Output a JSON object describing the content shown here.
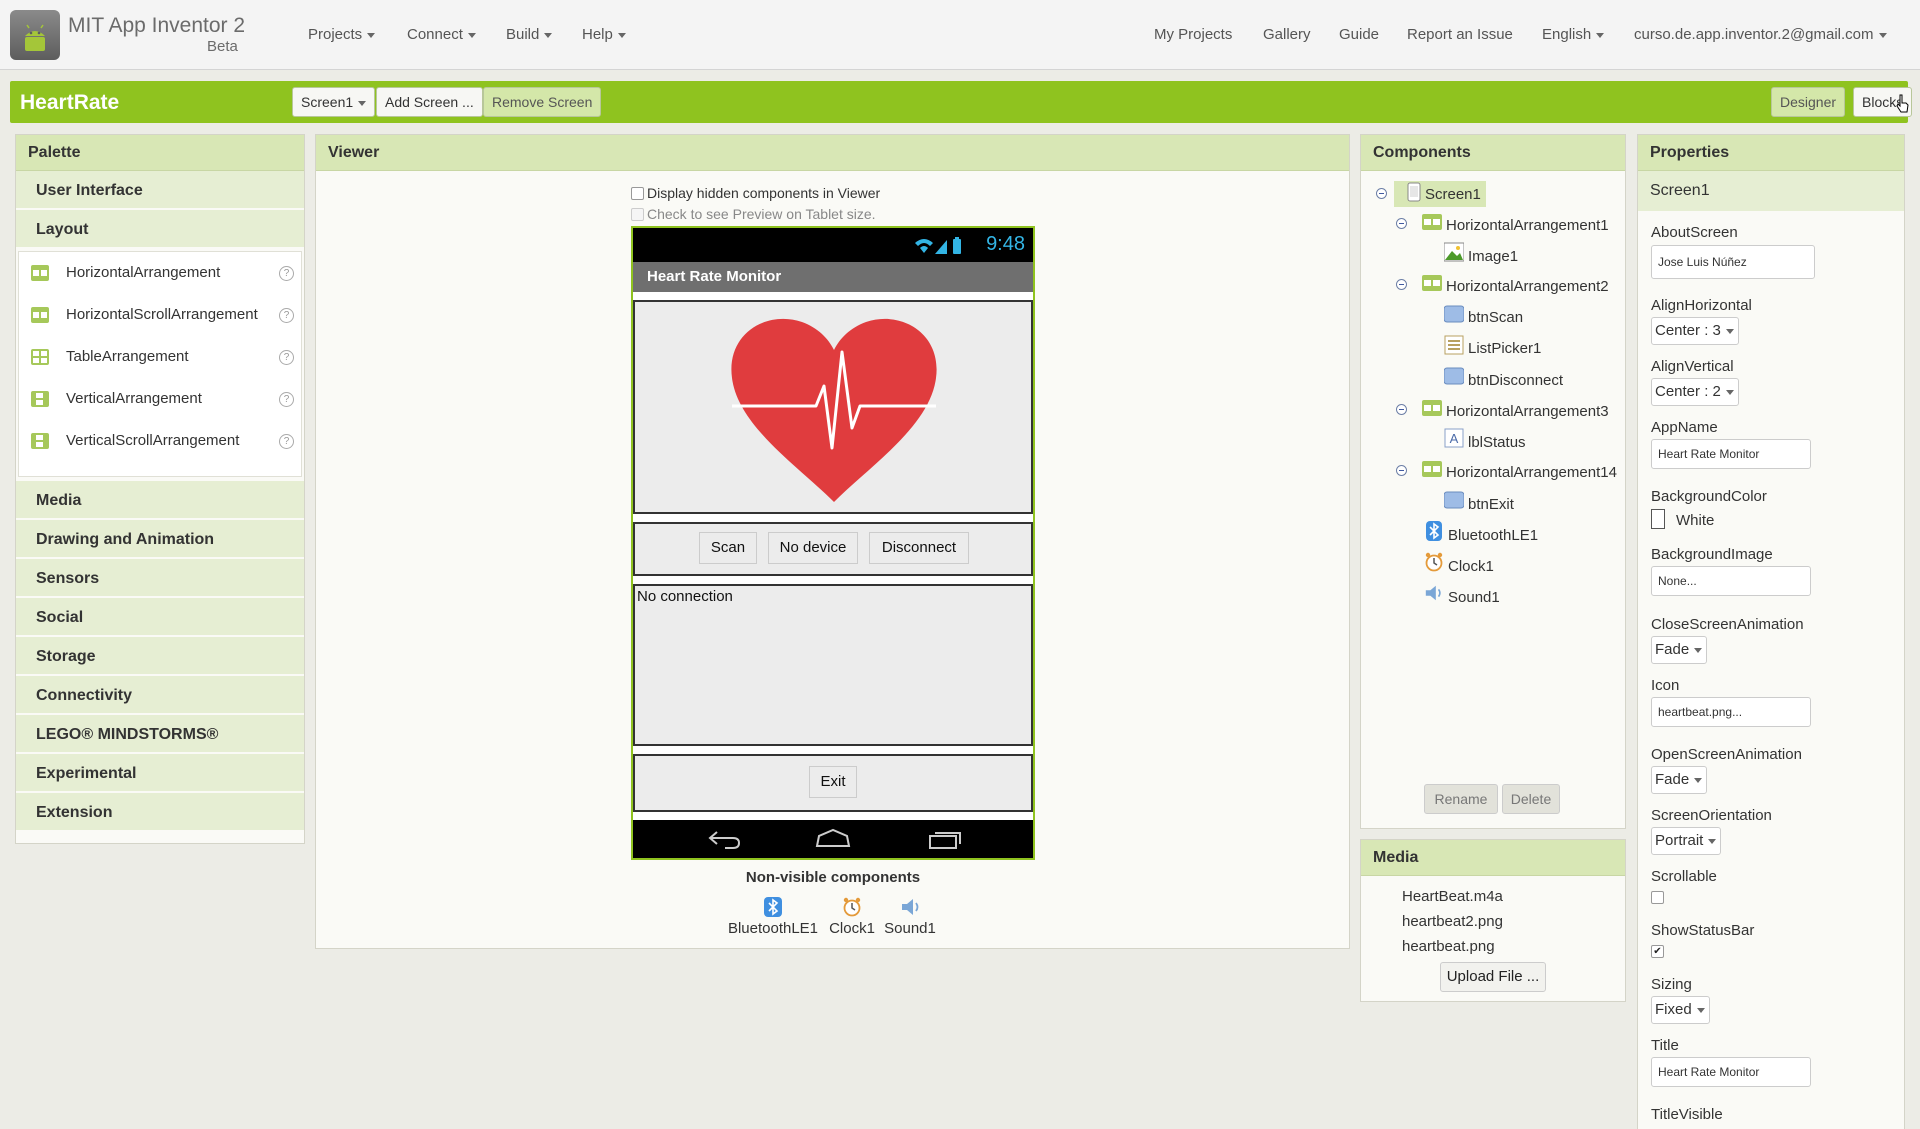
{
  "topbar": {
    "title": "MIT App Inventor 2",
    "subtitle": "Beta",
    "menus": [
      "Projects",
      "Connect",
      "Build",
      "Help"
    ],
    "links": [
      "My Projects",
      "Gallery",
      "Guide",
      "Report an Issue"
    ],
    "language": "English",
    "account": "curso.de.app.inventor.2@gmail.com"
  },
  "project": {
    "name": "HeartRate",
    "screen_select": "Screen1",
    "add_screen": "Add Screen ...",
    "remove_screen": "Remove Screen",
    "designer": "Designer",
    "blocks": "Blocks"
  },
  "palette": {
    "title": "Palette",
    "categories_top": [
      "User Interface",
      "Layout"
    ],
    "layout_items": [
      "HorizontalArrangement",
      "HorizontalScrollArrangement",
      "TableArrangement",
      "VerticalArrangement",
      "VerticalScrollArrangement"
    ],
    "help_glyph": "?",
    "categories_bottom": [
      "Media",
      "Drawing and Animation",
      "Sensors",
      "Social",
      "Storage",
      "Connectivity",
      "LEGO® MINDSTORMS®",
      "Experimental",
      "Extension"
    ]
  },
  "viewer": {
    "title": "Viewer",
    "display_hidden": "Display hidden components in Viewer",
    "tablet_preview": "Check to see Preview on Tablet size.",
    "phone_time": "9:48",
    "app_title": "Heart Rate Monitor",
    "buttons": [
      "Scan",
      "No device",
      "Disconnect"
    ],
    "status_text": "No connection",
    "exit": "Exit",
    "nonvisible_title": "Non-visible components",
    "nonvisible": [
      "BluetoothLE1",
      "Clock1",
      "Sound1"
    ]
  },
  "components": {
    "title": "Components",
    "tree": [
      {
        "label": "Screen1",
        "icon": "screen-icon"
      },
      {
        "label": "HorizontalArrangement1",
        "icon": "horizontal-arrangement-icon"
      },
      {
        "label": "Image1",
        "icon": "image-icon"
      },
      {
        "label": "HorizontalArrangement2",
        "icon": "horizontal-arrangement-icon"
      },
      {
        "label": "btnScan",
        "icon": "button-icon"
      },
      {
        "label": "ListPicker1",
        "icon": "listpicker-icon"
      },
      {
        "label": "btnDisconnect",
        "icon": "button-icon"
      },
      {
        "label": "HorizontalArrangement3",
        "icon": "horizontal-arrangement-icon"
      },
      {
        "label": "lblStatus",
        "icon": "label-icon"
      },
      {
        "label": "HorizontalArrangement14",
        "icon": "horizontal-arrangement-icon"
      },
      {
        "label": "btnExit",
        "icon": "button-icon"
      },
      {
        "label": "BluetoothLE1",
        "icon": "bluetooth-icon"
      },
      {
        "label": "Clock1",
        "icon": "clock-icon"
      },
      {
        "label": "Sound1",
        "icon": "sound-icon"
      }
    ],
    "rename": "Rename",
    "delete": "Delete"
  },
  "media": {
    "title": "Media",
    "files": [
      "HeartBeat.m4a",
      "heartbeat2.png",
      "heartbeat.png"
    ],
    "upload": "Upload File ..."
  },
  "properties": {
    "title": "Properties",
    "component": "Screen1",
    "about_label": "AboutScreen",
    "about_value": "Jose Luis Núñez",
    "alignh_label": "AlignHorizontal",
    "alignh_value": "Center : 3",
    "alignv_label": "AlignVertical",
    "alignv_value": "Center : 2",
    "appname_label": "AppName",
    "appname_value": "Heart Rate Monitor",
    "bgcolor_label": "BackgroundColor",
    "bgcolor_value": "White",
    "bgimage_label": "BackgroundImage",
    "bgimage_value": "None...",
    "closeanim_label": "CloseScreenAnimation",
    "closeanim_value": "Fade",
    "icon_label": "Icon",
    "icon_value": "heartbeat.png...",
    "openanim_label": "OpenScreenAnimation",
    "openanim_value": "Fade",
    "orient_label": "ScreenOrientation",
    "orient_value": "Portrait",
    "scrollable_label": "Scrollable",
    "scrollable_checked": false,
    "statusbar_label": "ShowStatusBar",
    "statusbar_checked": true,
    "check_glyph": "✔",
    "sizing_label": "Sizing",
    "sizing_value": "Fixed",
    "title_label": "Title",
    "title_value": "Heart Rate Monitor",
    "titlevisible_label": "TitleVisible"
  },
  "colors": {
    "accent_green": "#8fc31f",
    "header_green": "#d8e7b5",
    "heart_red": "#e03c3e",
    "status_blue": "#33b5e5"
  }
}
